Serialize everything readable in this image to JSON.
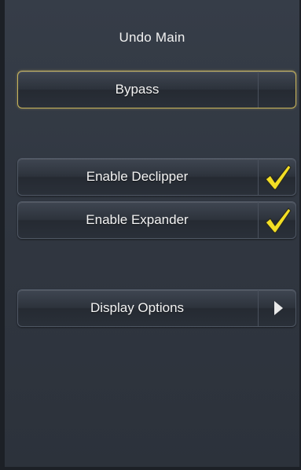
{
  "panel": {
    "title": "Undo Main"
  },
  "buttons": {
    "bypass": {
      "label": "Bypass",
      "selected": true
    },
    "enable_declipper": {
      "label": "Enable Declipper",
      "checked": true,
      "indicator_icon": "checkmark-icon"
    },
    "enable_expander": {
      "label": "Enable Expander",
      "checked": true,
      "indicator_icon": "checkmark-icon"
    },
    "display_options": {
      "label": "Display Options",
      "indicator_icon": "arrow-right-icon"
    }
  },
  "colors": {
    "background": "#303640",
    "selected_border": "#c9b45a",
    "checkmark": "#f3de24",
    "text": "#f4f4f4"
  }
}
